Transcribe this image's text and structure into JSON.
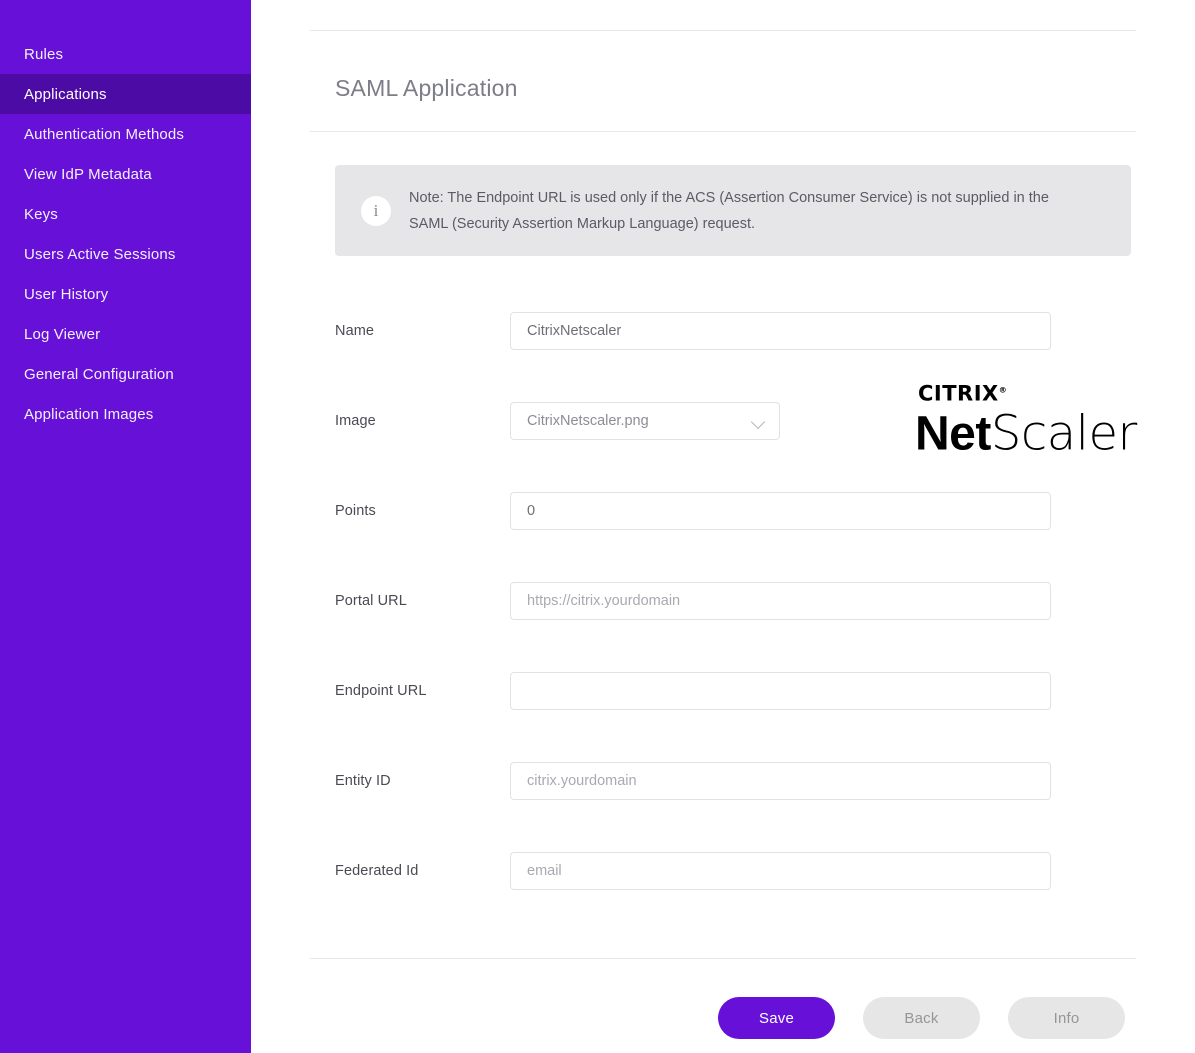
{
  "sidebar": {
    "background_color": "#6610d8",
    "active_color": "#4c0ba5",
    "items": [
      {
        "label": "Rules",
        "active": false
      },
      {
        "label": "Applications",
        "active": true
      },
      {
        "label": "Authentication Methods",
        "active": false
      },
      {
        "label": "View IdP Metadata",
        "active": false
      },
      {
        "label": "Keys",
        "active": false
      },
      {
        "label": "Users Active Sessions",
        "active": false
      },
      {
        "label": "User History",
        "active": false
      },
      {
        "label": "Log Viewer",
        "active": false
      },
      {
        "label": "General Configuration",
        "active": false
      },
      {
        "label": "Application Images",
        "active": false
      }
    ]
  },
  "header": {
    "title": "SAML Application"
  },
  "note": {
    "icon": "info-icon",
    "icon_glyph": "i",
    "text": "Note: The Endpoint URL is used only if the ACS (Assertion Consumer Service) is not supplied in the SAML (Security Assertion Markup Language) request.",
    "background_color": "#e6e6e8"
  },
  "form": {
    "fields": {
      "name": {
        "label": "Name",
        "value": "CitrixNetscaler",
        "placeholder": ""
      },
      "image": {
        "label": "Image",
        "value": "CitrixNetscaler.png",
        "options": [
          "CitrixNetscaler.png"
        ]
      },
      "points": {
        "label": "Points",
        "value": "0",
        "placeholder": ""
      },
      "portal_url": {
        "label": "Portal URL",
        "value": "",
        "placeholder": "https://citrix.yourdomain"
      },
      "endpoint_url": {
        "label": "Endpoint URL",
        "value": "",
        "placeholder": ""
      },
      "entity_id": {
        "label": "Entity ID",
        "value": "",
        "placeholder": "citrix.yourdomain"
      },
      "federated_id": {
        "label": "Federated Id",
        "value": "",
        "placeholder": "email"
      }
    }
  },
  "logo": {
    "brand": "CITRIX",
    "trademark": "®",
    "product_bold": "Net",
    "product_light": "Scaler"
  },
  "footer": {
    "save_label": "Save",
    "back_label": "Back",
    "info_label": "Info",
    "primary_color": "#6610d8",
    "secondary_color": "#e6e6e6"
  }
}
